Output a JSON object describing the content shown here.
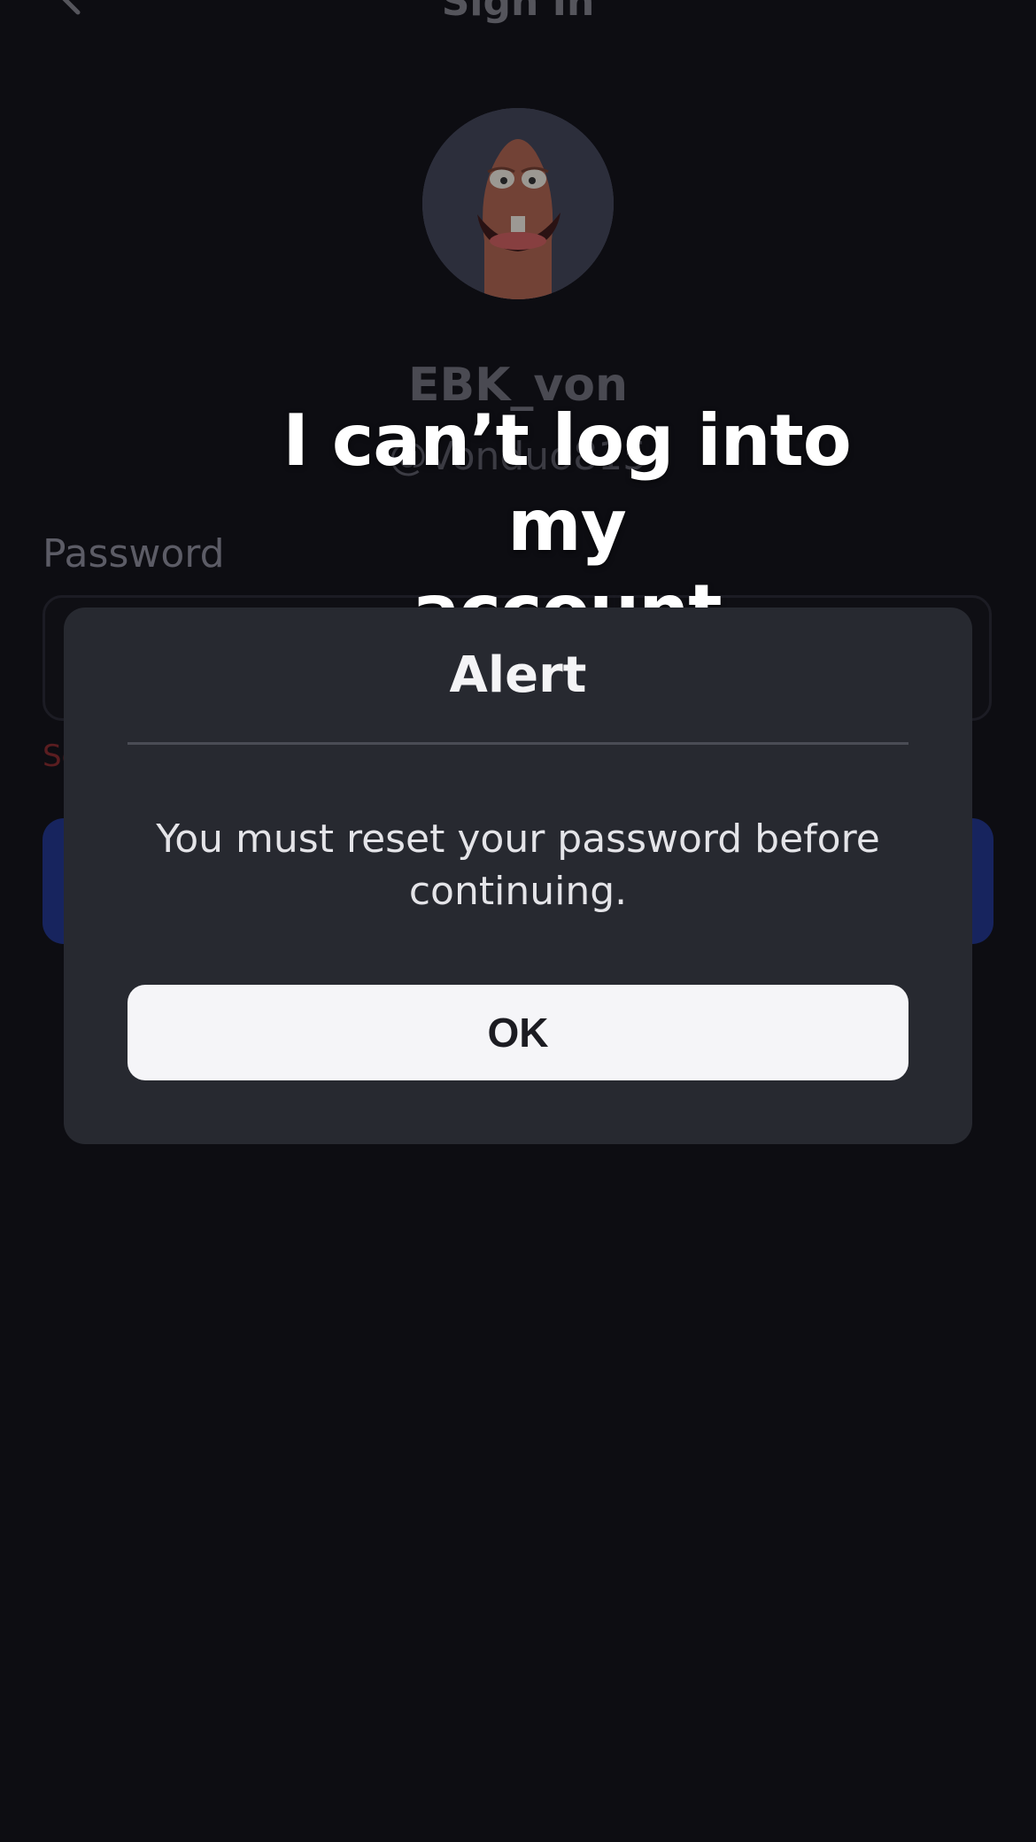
{
  "header": {
    "title": "Sign In",
    "back_icon": "chevron-left-icon"
  },
  "profile": {
    "display_name": "EBK_von",
    "username": "@Vonduo815"
  },
  "form": {
    "password_label": "Password",
    "error_text": "Se"
  },
  "caption": {
    "line1": "I can’t log into my",
    "line2": "account"
  },
  "dialog": {
    "title": "Alert",
    "message": "You must reset your password before continuing.",
    "ok_label": "OK"
  },
  "colors": {
    "background": "#0d0d12",
    "dialog_bg": "#272930",
    "button_bg": "#f5f5f8",
    "primary_button_dim": "#17245e",
    "error_dim": "#5a1d20"
  }
}
